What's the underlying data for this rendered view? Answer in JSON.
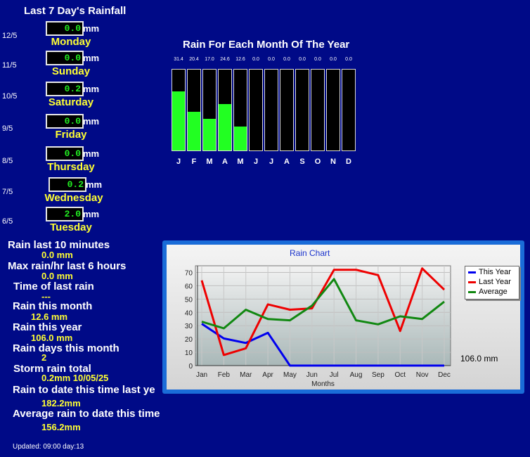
{
  "header": {
    "title": "Last 7 Day's Rainfall"
  },
  "unit": "mm",
  "days": [
    {
      "date": "12/5",
      "value": "0.0",
      "name": "Monday"
    },
    {
      "date": "11/5",
      "value": "0.0",
      "name": "Sunday"
    },
    {
      "date": "10/5",
      "value": "0.2",
      "name": "Saturday"
    },
    {
      "date": "9/5",
      "value": "0.0",
      "name": "Friday"
    },
    {
      "date": "8/5",
      "value": "0.0",
      "name": "Thursday"
    },
    {
      "date": "7/5",
      "value": "0.2",
      "name": "Wednesday"
    },
    {
      "date": "6/5",
      "value": "2.0",
      "name": "Tuesday"
    }
  ],
  "stats": [
    {
      "label": "Rain last 10 minutes",
      "value": "0.0 mm"
    },
    {
      "label": "Max rain/hr last 6 hours",
      "value": "0.0 mm"
    },
    {
      "label": "Time of last rain",
      "value": "---"
    },
    {
      "label": "Rain this month",
      "value": "12.6 mm"
    },
    {
      "label": "Rain this year",
      "value": "106.0 mm"
    },
    {
      "label": "Rain days this month",
      "value": "2"
    },
    {
      "label": "Storm rain total",
      "value": "0.2mm 10/05/25"
    },
    {
      "label": "Rain to date this time last ye",
      "value": "182.2mm"
    },
    {
      "label": "Average rain to date this time",
      "value": "156.2mm"
    }
  ],
  "updated": "Updated: 09:00 day:13",
  "monthly": {
    "title": "Rain For Each Month Of The Year",
    "letters": [
      "J",
      "F",
      "M",
      "A",
      "M",
      "J",
      "J",
      "A",
      "S",
      "O",
      "N",
      "D"
    ],
    "value_labels": [
      "31.4",
      "20.4",
      "17.0",
      "24.6",
      "12.6",
      "0.0",
      "0.0",
      "0.0",
      "0.0",
      "0.0",
      "0.0",
      "0.0"
    ],
    "values": [
      31.4,
      20.4,
      17.0,
      24.6,
      12.6,
      0,
      0,
      0,
      0,
      0,
      0,
      0
    ],
    "scale_max": 43,
    "bar_color": "#22ff22"
  },
  "chart_data": {
    "type": "line",
    "title": "Rain Chart",
    "xlabel": "Months",
    "ylabel": "",
    "categories": [
      "Jan",
      "Feb",
      "Mar",
      "Apr",
      "May",
      "Jun",
      "Jul",
      "Aug",
      "Sep",
      "Oct",
      "Nov",
      "Dec"
    ],
    "ylim": [
      0,
      75
    ],
    "yticks": [
      0,
      10,
      20,
      30,
      40,
      50,
      60,
      70
    ],
    "grid": true,
    "legend": "top-right",
    "series": [
      {
        "name": "This Year",
        "color": "#0000ee",
        "values": [
          31.4,
          20.4,
          17.0,
          24.6,
          0,
          0,
          0,
          0,
          0,
          0,
          0,
          0
        ]
      },
      {
        "name": "Last Year",
        "color": "#ee0000",
        "values": [
          64,
          8,
          13,
          46,
          42,
          43,
          72,
          72,
          68,
          26,
          73,
          57
        ]
      },
      {
        "name": "Average",
        "color": "#118811",
        "values": [
          33,
          28,
          42,
          35,
          34,
          45,
          65,
          34,
          31,
          37,
          35,
          48
        ]
      }
    ],
    "annotation": "106.0 mm"
  }
}
